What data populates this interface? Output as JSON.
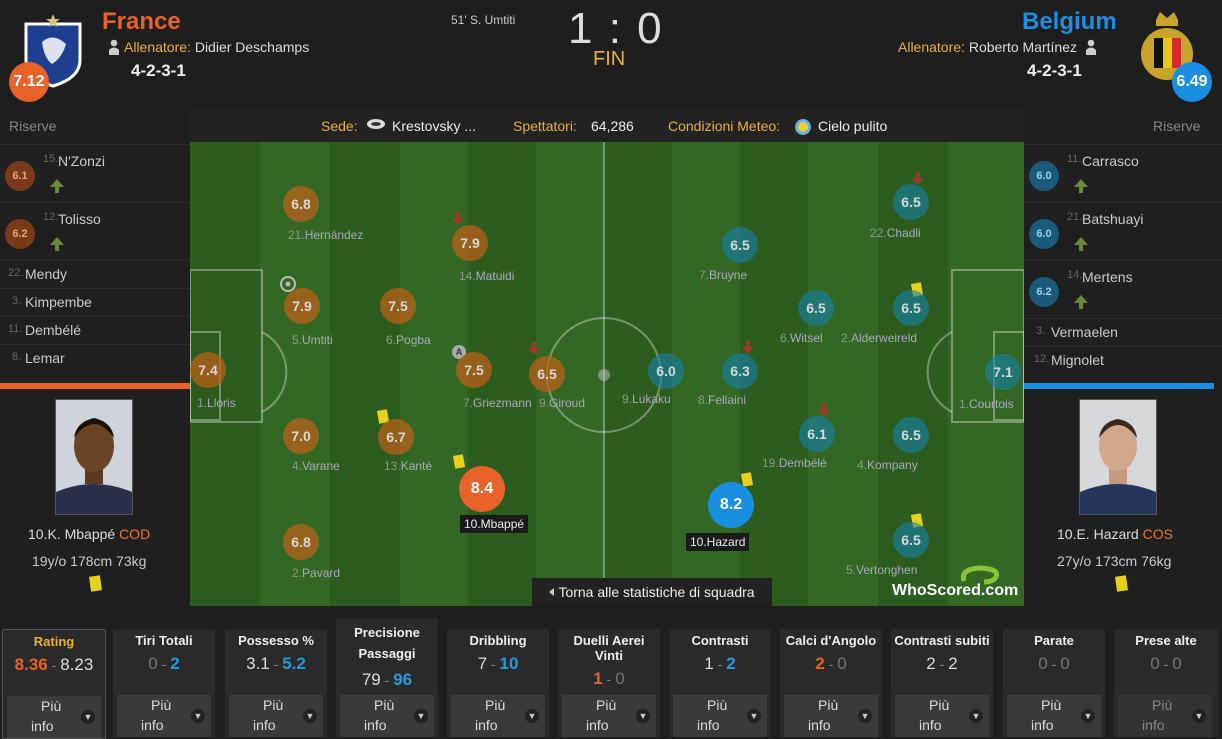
{
  "home": {
    "name": "France",
    "coach_label": "Allenatore:",
    "coach": "Didier Deschamps",
    "formation": "4-2-3-1",
    "rating": "7.12",
    "color": "#e8622a"
  },
  "away": {
    "name": "Belgium",
    "coach_label": "Allenatore:",
    "coach": "Roberto Martínez",
    "formation": "4-2-3-1",
    "rating": "6.49",
    "color": "#1a8ee0"
  },
  "match": {
    "score": "1 : 0",
    "status": "FIN",
    "scorer": "51' S. Umtiti"
  },
  "info": {
    "venue_label": "Sede:",
    "venue": "Krestovsky ...",
    "attendance_label": "Spettatori:",
    "attendance": "64,286",
    "weather_label": "Condizioni Meteo:",
    "weather": "Cielo pulito"
  },
  "home_subs": {
    "header": "Riserve",
    "rated": [
      {
        "num": "15.",
        "name": "N'Zonzi",
        "rating": "6.1"
      },
      {
        "num": "12.",
        "name": "Tolisso",
        "rating": "6.2"
      }
    ],
    "unused": [
      {
        "num": "22.",
        "name": "Mendy"
      },
      {
        "num": "3.",
        "name": "Kimpembe"
      },
      {
        "num": "11.",
        "name": "Dembélé"
      },
      {
        "num": "8.",
        "name": "Lemar"
      }
    ]
  },
  "away_subs": {
    "header": "Riserve",
    "rated": [
      {
        "num": "11.",
        "name": "Carrasco",
        "rating": "6.0"
      },
      {
        "num": "21.",
        "name": "Batshuayi",
        "rating": "6.0"
      },
      {
        "num": "14.",
        "name": "Mertens",
        "rating": "6.2"
      }
    ],
    "unused": [
      {
        "num": "3.",
        "name": "Vermaelen"
      },
      {
        "num": "12.",
        "name": "Mignolet"
      }
    ]
  },
  "home_players": [
    {
      "rating": "6.8",
      "num": "21.",
      "name": "Hernández"
    },
    {
      "rating": "7.9",
      "num": "14.",
      "name": "Matuidi"
    },
    {
      "rating": "7.9",
      "num": "5.",
      "name": "Umtiti"
    },
    {
      "rating": "7.5",
      "num": "6.",
      "name": "Pogba"
    },
    {
      "rating": "7.4",
      "num": "1.",
      "name": "Lloris"
    },
    {
      "rating": "7.5",
      "num": "7.",
      "name": "Griezmann"
    },
    {
      "rating": "6.5",
      "num": "9.",
      "name": "Giroud"
    },
    {
      "rating": "7.0",
      "num": "4.",
      "name": "Varane"
    },
    {
      "rating": "6.7",
      "num": "13.",
      "name": "Kanté"
    },
    {
      "rating": "6.8",
      "num": "2.",
      "name": "Pavard"
    }
  ],
  "away_players": [
    {
      "rating": "6.5",
      "num": "22.",
      "name": "Chadli"
    },
    {
      "rating": "6.5",
      "num": "7.",
      "name": "Bruyne"
    },
    {
      "rating": "6.5",
      "num": "6.",
      "name": "Witsel"
    },
    {
      "rating": "6.5",
      "num": "2.",
      "name": "Alderweireld"
    },
    {
      "rating": "6.0",
      "num": "9.",
      "name": "Lukaku"
    },
    {
      "rating": "6.3",
      "num": "8.",
      "name": "Fellaini"
    },
    {
      "rating": "7.1",
      "num": "1.",
      "name": "Courtois"
    },
    {
      "rating": "6.1",
      "num": "19.",
      "name": "Dembélé"
    },
    {
      "rating": "6.5",
      "num": "4.",
      "name": "Kompany"
    },
    {
      "rating": "6.5",
      "num": "5.",
      "name": "Vertonghen"
    }
  ],
  "motm_home": {
    "rating": "8.4",
    "label": "10.Mbappé"
  },
  "motm_away": {
    "rating": "8.2",
    "label": "10.Hazard"
  },
  "back_button": "Torna alle statistiche di squadra",
  "watermark": "WhoScored.com",
  "card_home": {
    "name": "10.K. Mbappé",
    "pos": "COD",
    "age": "19",
    "age_unit": "y/o",
    "height": "178",
    "height_unit": "cm",
    "weight": "73",
    "weight_unit": "kg"
  },
  "card_away": {
    "name": "10.E. Hazard",
    "pos": "COS",
    "age": "27",
    "age_unit": "y/o",
    "height": "173",
    "height_unit": "cm",
    "weight": "76",
    "weight_unit": "kg"
  },
  "stats": [
    {
      "title": "Rating",
      "home": "8.36",
      "away": "8.23",
      "more": [
        "Più",
        "info"
      ]
    },
    {
      "title": "Tiri Totali",
      "home": "0",
      "away": "2",
      "more": [
        "Più",
        "info"
      ]
    },
    {
      "title": "Possesso %",
      "home": "3.1",
      "away": "5.2",
      "more": [
        "Più",
        "info"
      ]
    },
    {
      "title": "Precisione Passaggi",
      "home": "79",
      "away": "96",
      "more": [
        "Più",
        "info"
      ]
    },
    {
      "title": "Dribbling",
      "home": "7",
      "away": "10",
      "more": [
        "Più",
        "info"
      ]
    },
    {
      "title": "Duelli Aerei Vinti",
      "home": "1",
      "away": "0",
      "more": [
        "Più",
        "info"
      ]
    },
    {
      "title": "Contrasti",
      "home": "1",
      "away": "2",
      "more": [
        "Più",
        "info"
      ]
    },
    {
      "title": "Calci d'Angolo",
      "home": "2",
      "away": "0",
      "more": [
        "Più",
        "info"
      ]
    },
    {
      "title": "Contrasti subiti",
      "home": "2",
      "away": "2",
      "more": [
        "Più",
        "info"
      ]
    },
    {
      "title": "Parate",
      "home": "0",
      "away": "0",
      "more": [
        "Più",
        "info"
      ]
    },
    {
      "title": "Prese alte",
      "home": "0",
      "away": "0",
      "more": [
        "Più",
        "info"
      ]
    }
  ],
  "colors": {
    "home_accent": "#e8622a",
    "away_accent": "#1a8ee0",
    "label_gold": "#e8b23a",
    "yellow_card": "#e6d21a"
  }
}
